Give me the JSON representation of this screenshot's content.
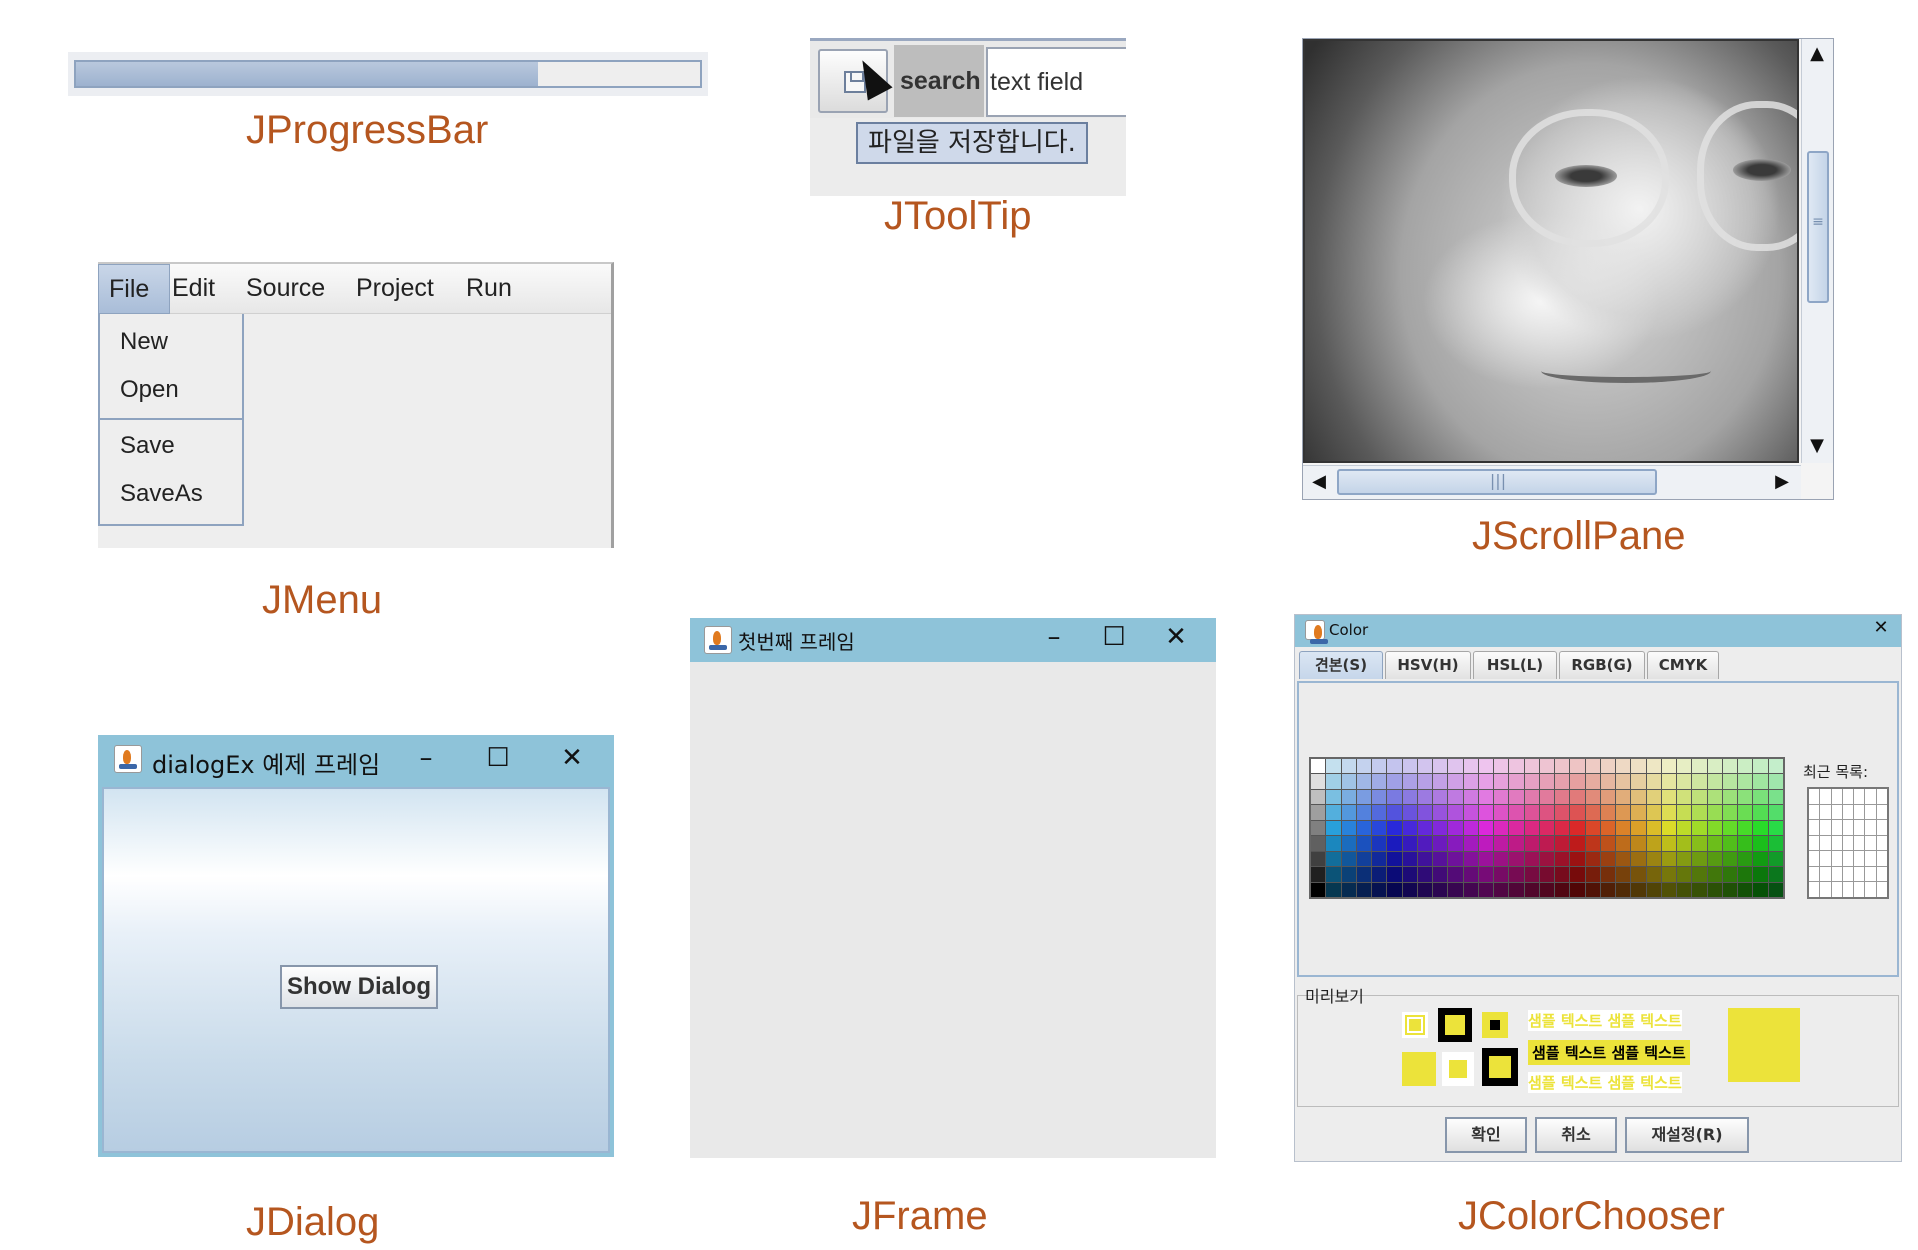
{
  "captions": {
    "progress": "JProgressBar",
    "tooltip": "JToolTip",
    "scrollpane": "JScrollPane",
    "menu": "JMenu",
    "dialog": "JDialog",
    "frame": "JFrame",
    "colorchooser": "JColorChooser"
  },
  "progress": {
    "value_percent": 74,
    "fill_color": "#9db2cf"
  },
  "tooltip": {
    "search_label": "search",
    "field_value": "text field",
    "tip_text": "파일을 저장합니다."
  },
  "scrollpane": {
    "up_arrow": "▲",
    "down_arrow": "▼",
    "left_arrow": "◀",
    "right_arrow": "▶",
    "vgrip": "≡",
    "hgrip": "|||"
  },
  "menu": {
    "bar": [
      "File",
      "Edit",
      "Source",
      "Project",
      "Run"
    ],
    "items": [
      "New",
      "Open",
      "Save",
      "SaveAs"
    ]
  },
  "dialog": {
    "title": "dialogEx 예제 프레임",
    "button": "Show Dialog",
    "controls": {
      "min": "–",
      "max": "☐",
      "close": "✕"
    }
  },
  "frame": {
    "title": "첫번째 프레임",
    "controls": {
      "min": "–",
      "max": "☐",
      "close": "✕"
    }
  },
  "colorchooser": {
    "title": "Color",
    "close": "✕",
    "tabs": [
      "견본(S)",
      "HSV(H)",
      "HSL(L)",
      "RGB(G)",
      "CMYK"
    ],
    "recent_label": "최근 목록:",
    "preview_label": "미리보기",
    "sample_text": "샘플 텍스트  샘플 텍스트",
    "selected_color": "#ece33a",
    "buttons": [
      "확인",
      "취소",
      "재설정(R)"
    ]
  }
}
